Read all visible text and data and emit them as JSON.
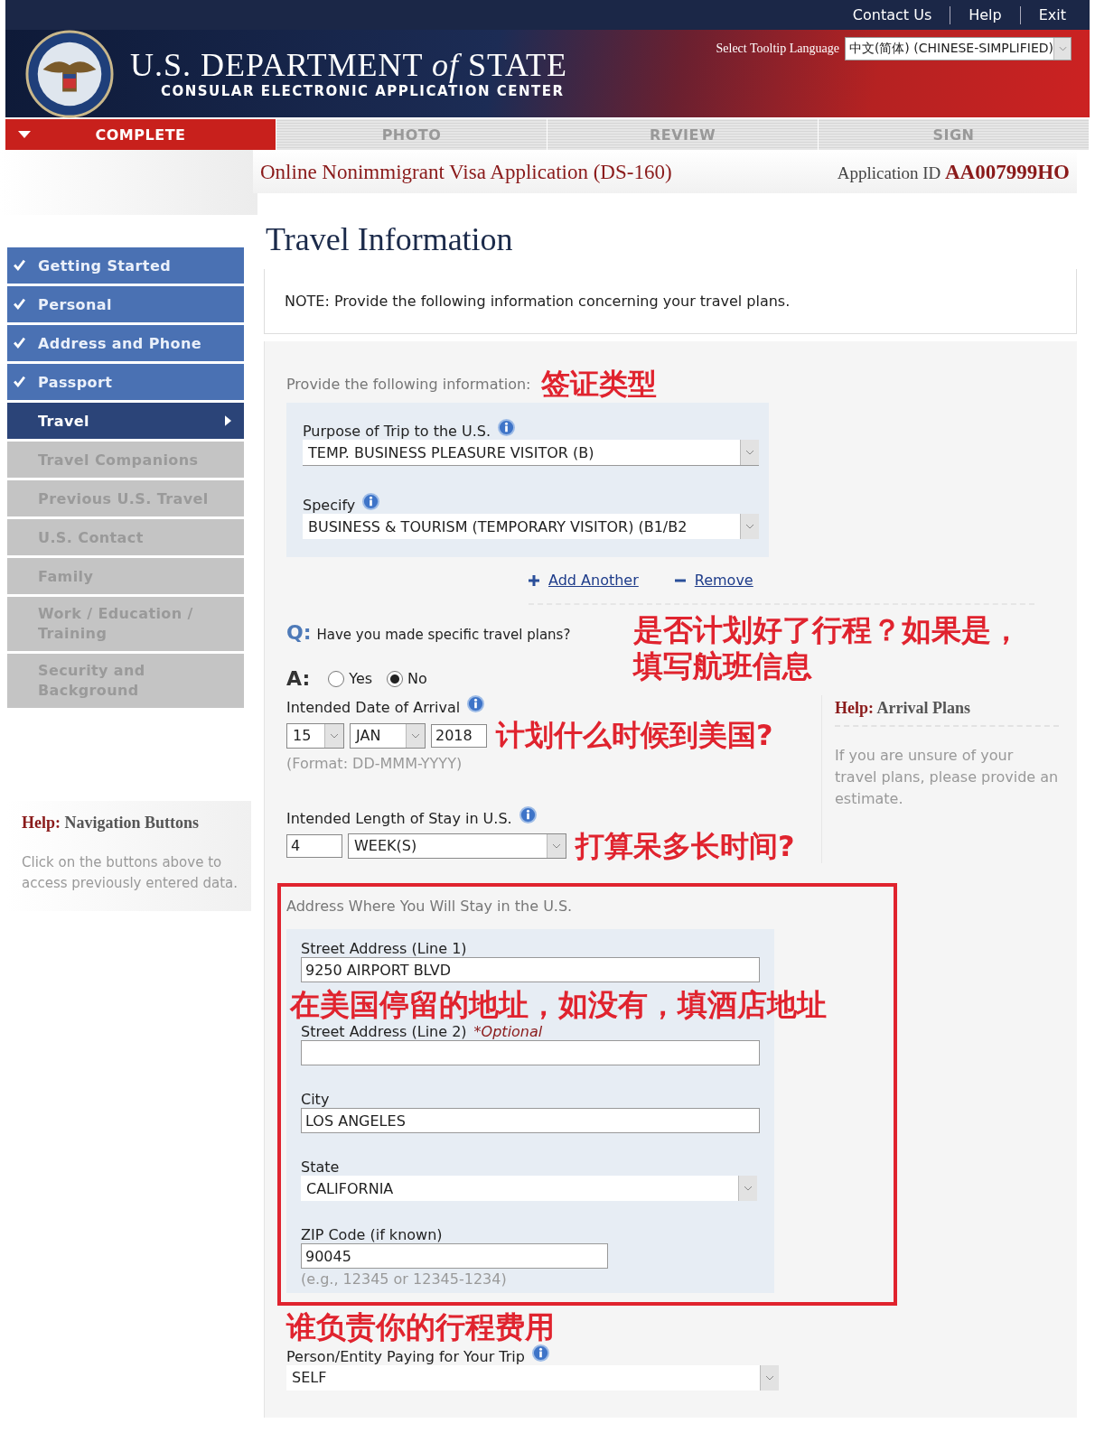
{
  "top_links": [
    "Contact Us",
    "Help",
    "Exit"
  ],
  "header": {
    "title": "U.S. DEPARTMENT *of* STATE",
    "subtitle": "CONSULAR ELECTRONIC APPLICATION CENTER",
    "tooltip_label": "Select Tooltip Language",
    "tooltip_value": "中文(简体) (CHINESE-SIMPLIFIED)"
  },
  "steps": [
    {
      "label": "COMPLETE",
      "selected": true
    },
    {
      "label": "PHOTO",
      "selected": false
    },
    {
      "label": "REVIEW",
      "selected": false
    },
    {
      "label": "SIGN",
      "selected": false
    }
  ],
  "form_title": "Online Nonimmigrant Visa Application (DS-160)",
  "application_id": {
    "label": "Application ID",
    "value": "AA007999HO"
  },
  "sidebar": {
    "items": [
      {
        "label": "Getting Started",
        "completed": true,
        "selected": false
      },
      {
        "label": "Personal",
        "completed": true,
        "selected": false
      },
      {
        "label": "Address and Phone",
        "completed": true,
        "selected": false
      },
      {
        "label": "Passport",
        "completed": true,
        "selected": false
      },
      {
        "label": "Travel",
        "completed": false,
        "selected": true
      },
      {
        "label": "Travel Companions",
        "completed": false,
        "selected": false
      },
      {
        "label": "Previous U.S. Travel",
        "completed": false,
        "selected": false
      },
      {
        "label": "U.S. Contact",
        "completed": false,
        "selected": false
      },
      {
        "label": "Family",
        "completed": false,
        "selected": false
      },
      {
        "label": "Work / Education / Training",
        "completed": false,
        "selected": false
      },
      {
        "label": "Security and Background",
        "completed": false,
        "selected": false
      }
    ],
    "help": {
      "label": "Help:",
      "title": "Navigation Buttons",
      "text": "Click on the buttons above to access previously entered data."
    }
  },
  "page_title": "Travel Information",
  "note": "NOTE: Provide the following information concerning your travel plans.",
  "purpose": {
    "intro": "Provide the following information:",
    "annotation": "签证类型",
    "purpose_label": "Purpose of Trip to the U.S.",
    "purpose_value": "TEMP. BUSINESS PLEASURE VISITOR (B)",
    "specify_label": "Specify",
    "specify_value": "BUSINESS & TOURISM (TEMPORARY VISITOR) (B1/B2",
    "add_another": "Add Another",
    "remove": "Remove"
  },
  "plans": {
    "q_mark": "Q:",
    "question": "Have you made specific travel plans?",
    "a_mark": "A:",
    "options": [
      {
        "label": "Yes",
        "selected": false
      },
      {
        "label": "No",
        "selected": true
      }
    ],
    "annotation": "是否计划好了行程？如果是，填写航班信息"
  },
  "arrival": {
    "label": "Intended Date of Arrival",
    "day": "15",
    "month": "JAN",
    "year": "2018",
    "format": "(Format: DD-MMM-YYYY)",
    "annotation": "计划什么时候到美国?"
  },
  "arrival_help": {
    "label": "Help:",
    "title": "Arrival Plans",
    "text": "If you are unsure of your travel plans, please provide an estimate."
  },
  "stay": {
    "label": "Intended Length of Stay in U.S.",
    "number": "4",
    "unit": "WEEK(S)",
    "annotation": "打算呆多长时间?"
  },
  "address": {
    "heading": "Address Where You Will Stay in the U.S.",
    "street1_label": "Street Address (Line 1)",
    "street1": "9250 AIRPORT BLVD",
    "annotation": "在美国停留的地址，如没有，填酒店地址",
    "street2_label": "Street Address (Line 2)",
    "optional": "*Optional",
    "city_label": "City",
    "city": "LOS ANGELES",
    "state_label": "State",
    "state": "CALIFORNIA",
    "zip_label": "ZIP Code (if known)",
    "zip": "90045",
    "zip_hint": "(e.g., 12345 or 12345-1234)"
  },
  "payer": {
    "annotation": "谁负责你的行程费用",
    "label": "Person/Entity Paying for Your Trip",
    "value": "SELF"
  }
}
